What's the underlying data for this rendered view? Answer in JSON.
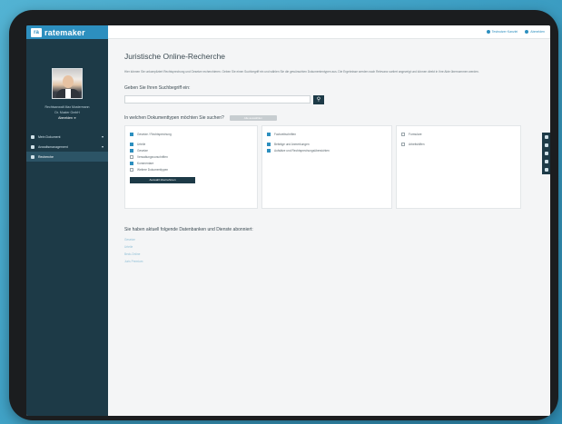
{
  "app": {
    "brand_logo": "ra",
    "brand_name": "ratemaker"
  },
  "topbar": {
    "user_label": "Testnutzer Kanzlei",
    "logout_label": "Abmelden"
  },
  "profile": {
    "line1": "Rechtsanwalt Max Mustermann",
    "line2": "Dr. Muster GmbH",
    "logout": "Abmelden ➜"
  },
  "sidebar": {
    "items": [
      {
        "label": "Mein Dokument",
        "icon": "document-icon",
        "chevron": "▾"
      },
      {
        "label": "Anwaltsmanagement",
        "icon": "briefcase-icon",
        "chevron": "▾"
      },
      {
        "label": "Recherche",
        "icon": "search-icon",
        "chevron": ""
      }
    ]
  },
  "main": {
    "title": "Juristische Online-Recherche",
    "intro": "Hier können Sie unkompliziert Rechtsprechung und Gesetze recherchieren. Geben Sie einen Suchbegriff ein und wählen Sie die gewünschten Dokumententypen aus. Die Ergebnisse werden nach Relevanz sortiert angezeigt und können direkt in Ihre Akte übernommen werden.",
    "search_label": "Geben Sie Ihren Suchbegriff ein:",
    "search_placeholder": "",
    "search_button": "⚲",
    "question": "In welchen Dokumenttypen möchten Sie suchen?",
    "question_pill": "Alle auswählen",
    "card1": {
      "header": "Gesetze / Rechtsprechung",
      "options": [
        {
          "label": "Urteile",
          "checked": true
        },
        {
          "label": "Gesetze",
          "checked": true
        },
        {
          "label": "Verwaltungsvorschriften",
          "checked": false
        },
        {
          "label": "Kommentare",
          "checked": true
        },
        {
          "label": "Weitere Dokumenttypen",
          "checked": false
        }
      ],
      "button": "Auswahl übernehmen"
    },
    "card2": {
      "header": "Fachzeitschriften",
      "options": [
        {
          "label": "Beiträge und Anmerkungen",
          "checked": true
        },
        {
          "label": "Aufsätze und Rechtsprechungsübersichten",
          "checked": true
        }
      ]
    },
    "card3": {
      "options": [
        {
          "label": "Formulare",
          "checked": false
        },
        {
          "label": "Arbeitshilfen",
          "checked": false
        }
      ]
    },
    "sources_title": "Sie haben aktuell folgende Datenbanken und Dienste abonniert:",
    "sources": [
      "Gesetze",
      "Urteile",
      "Beck-Online",
      "Juris Premium"
    ]
  },
  "colors": {
    "sidebar": "#1d3a47",
    "accent": "#2d8fbf",
    "background": "#3d9fc4"
  }
}
